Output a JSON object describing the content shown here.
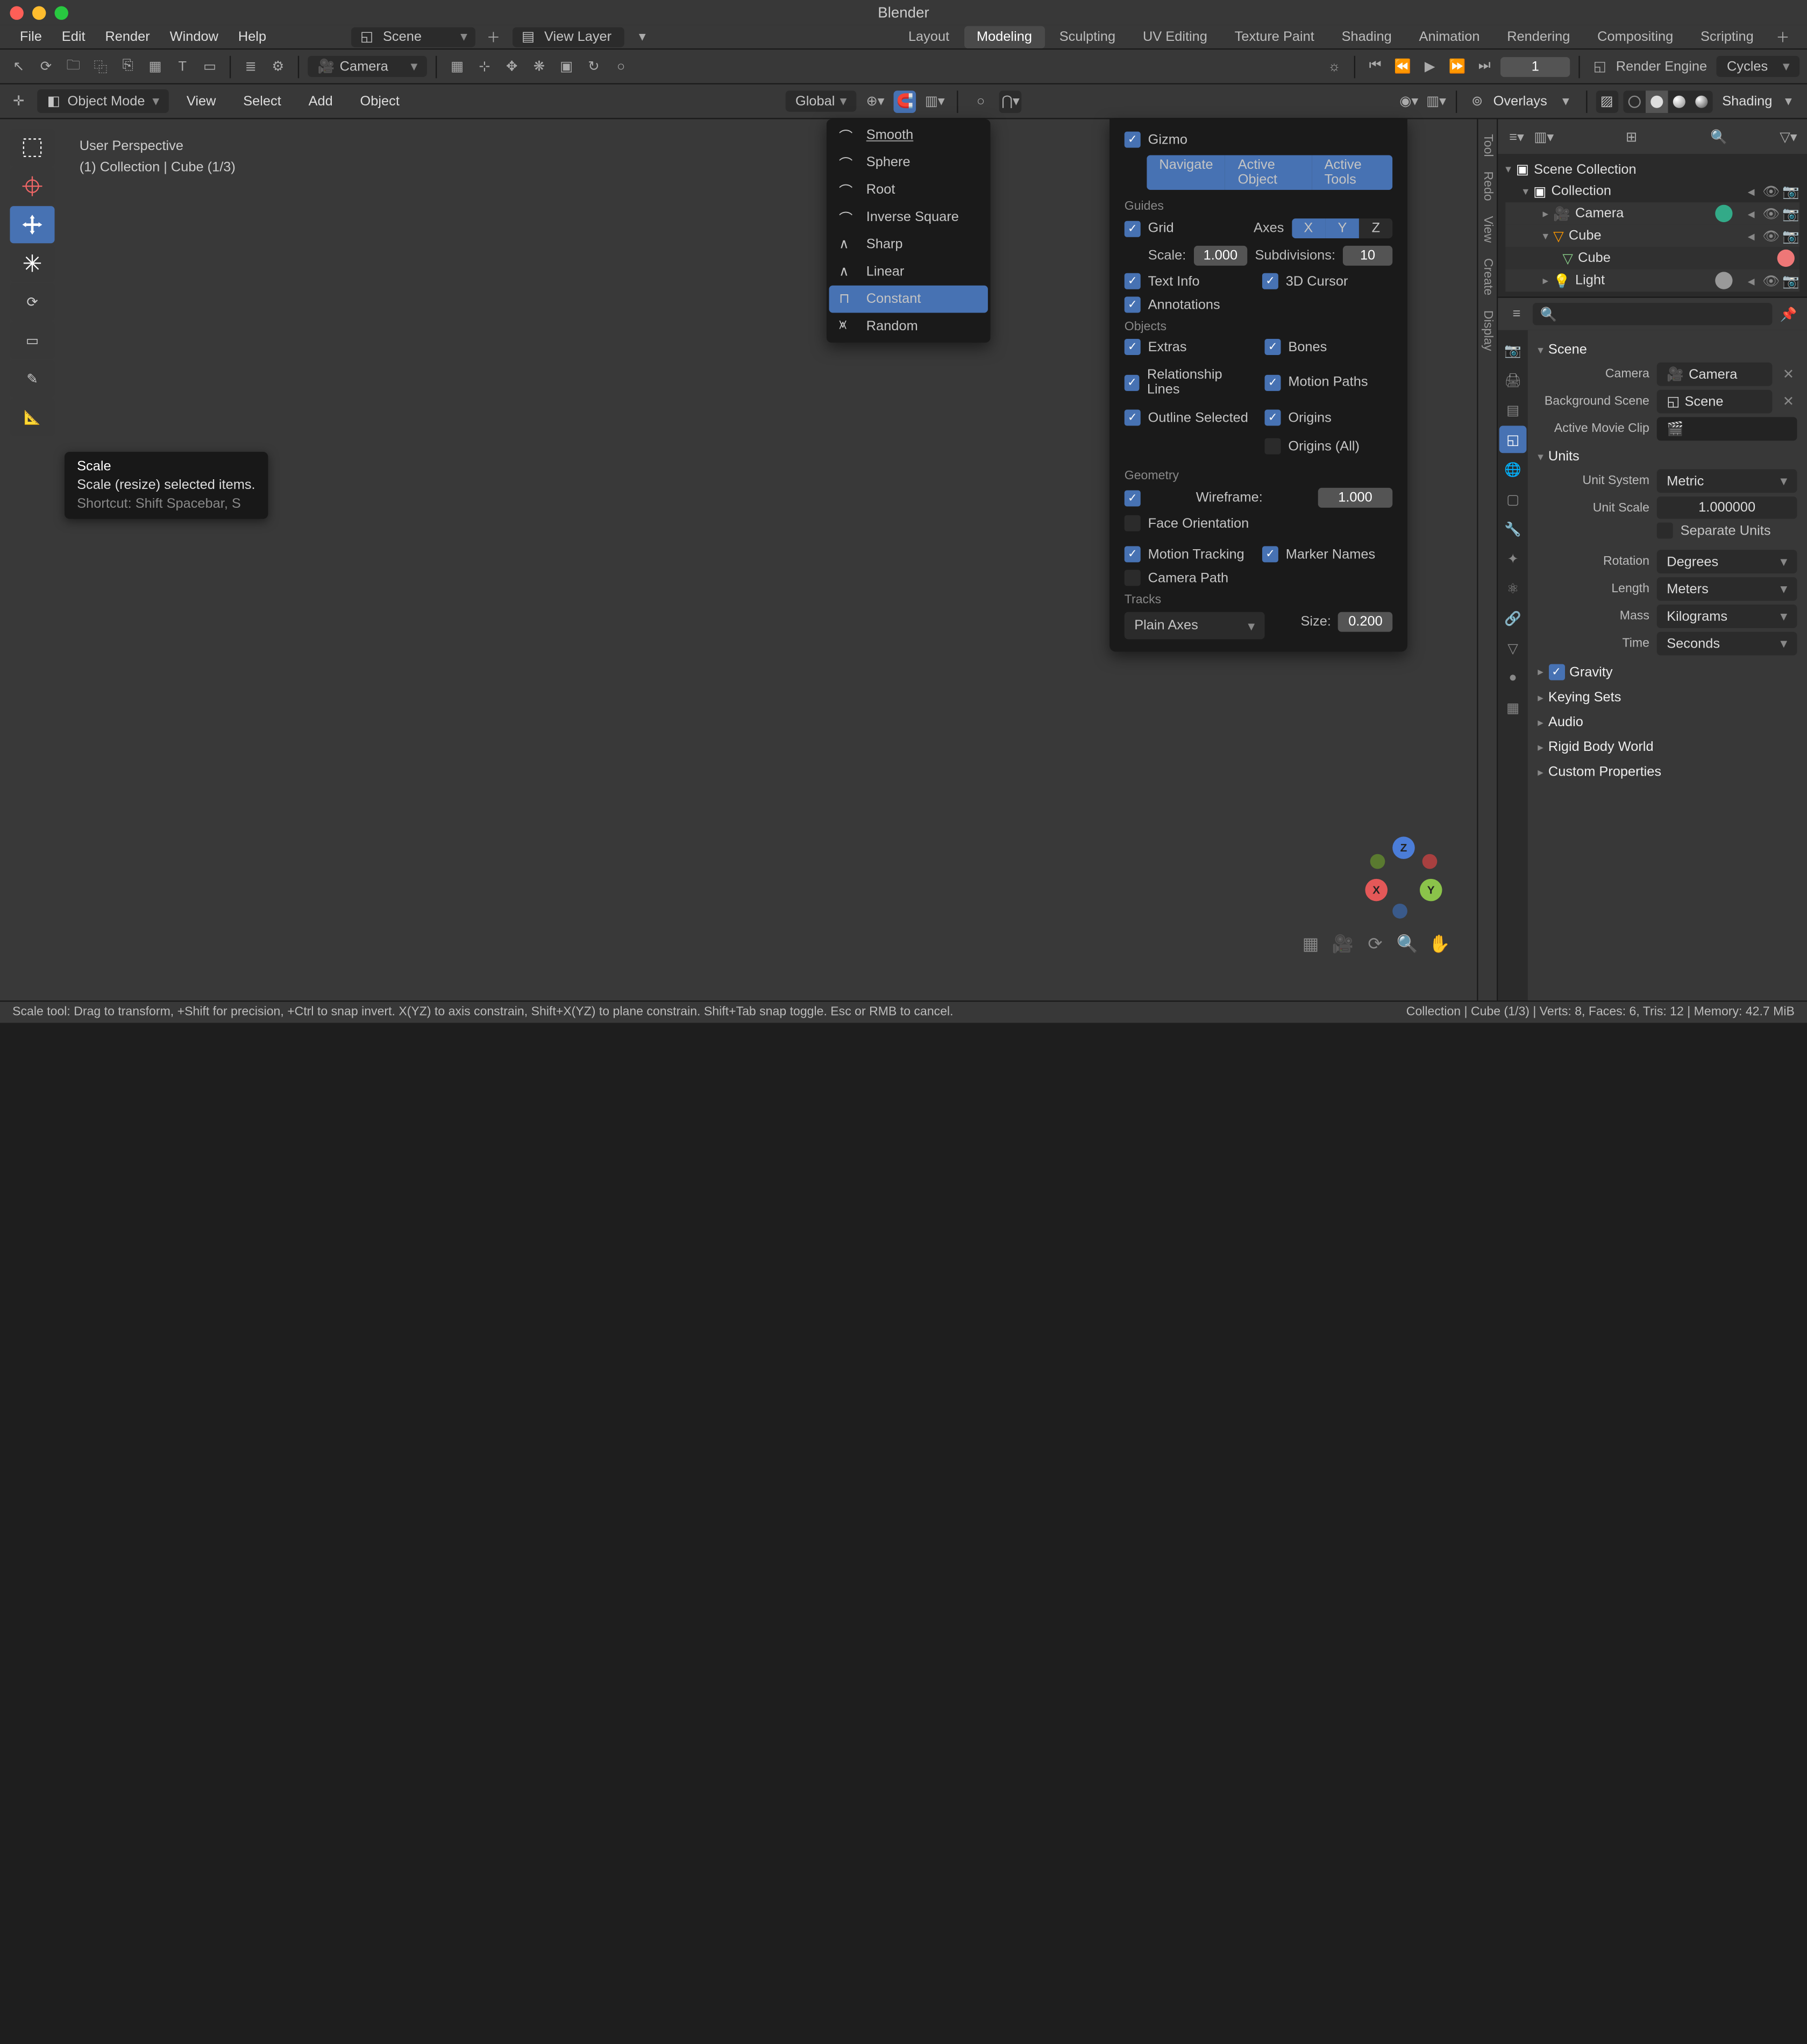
{
  "app_title": "Blender",
  "traffic": {},
  "menu": [
    "File",
    "Edit",
    "Render",
    "Window",
    "Help"
  ],
  "scene_sel": {
    "label": "Scene"
  },
  "layer_sel": {
    "label": "View Layer"
  },
  "workspace_tabs": [
    "Layout",
    "Modeling",
    "Sculpting",
    "UV Editing",
    "Texture Paint",
    "Shading",
    "Animation",
    "Rendering",
    "Compositing",
    "Scripting"
  ],
  "workspace_active": "Modeling",
  "toolrow": {
    "camera": "Camera",
    "frame": "1",
    "render_engine_label": "Render Engine",
    "render_engine": "Cycles"
  },
  "view_header": {
    "mode": "Object Mode",
    "menus": [
      "View",
      "Select",
      "Add",
      "Object"
    ],
    "orientation": "Global",
    "overlays": "Overlays",
    "shading": "Shading"
  },
  "left_tools": [
    "select-box",
    "cursor",
    "move",
    "rotate",
    "scale",
    "transform",
    "annotate",
    "measure"
  ],
  "tooltip": {
    "title": "Scale",
    "desc": "Scale (resize) selected items.",
    "shortcut": "Shortcut: Shift Spacebar, S"
  },
  "vp_info": {
    "line1": "User Perspective",
    "line2": "(1) Collection | Cube (1/3)"
  },
  "falloff_menu": [
    "Smooth",
    "Sphere",
    "Root",
    "Inverse Square",
    "Sharp",
    "Linear",
    "Constant",
    "Random"
  ],
  "falloff_sel": "Constant",
  "overlays_panel": {
    "gizmo": "Gizmo",
    "pills": [
      "Navigate",
      "Active Object",
      "Active Tools"
    ],
    "guides": "Guides",
    "grid": "Grid",
    "axes": "Axes",
    "axX": "X",
    "axY": "Y",
    "axZ": "Z",
    "scale_l": "Scale:",
    "scale_v": "1.000",
    "subdiv_l": "Subdivisions:",
    "subdiv_v": "10",
    "text_info": "Text Info",
    "cursor3d": "3D Cursor",
    "annotations": "Annotations",
    "objects": "Objects",
    "extras": "Extras",
    "bones": "Bones",
    "rel_lines": "Relationship Lines",
    "motion": "Motion Paths",
    "outline_sel": "Outline Selected",
    "origins": "Origins",
    "origins_all": "Origins (All)",
    "geometry": "Geometry",
    "wireframe_l": "Wireframe:",
    "wireframe_v": "1.000",
    "face_orient": "Face Orientation",
    "motion_track": "Motion Tracking",
    "marker_names": "Marker Names",
    "camera_path": "Camera Path",
    "tracks": "Tracks",
    "plain_axes": "Plain Axes",
    "size_l": "Size:",
    "size_v": "0.200"
  },
  "right_tabs": [
    "Tool",
    "Redo",
    "View",
    "Create",
    "Display"
  ],
  "outliner": {
    "root": "Scene Collection",
    "items": [
      {
        "name": "Collection",
        "level": 1,
        "exp": true
      },
      {
        "name": "Camera",
        "level": 2,
        "circle": "teal"
      },
      {
        "name": "Cube",
        "level": 2,
        "exp": true,
        "tri": true
      },
      {
        "name": "Cube",
        "level": 3,
        "circle": "coral"
      },
      {
        "name": "Light",
        "level": 2,
        "circle": "gray"
      }
    ]
  },
  "props": {
    "search_ph": "",
    "scene_head": "Scene",
    "camera_l": "Camera",
    "camera_v": "Camera",
    "bgscene_l": "Background Scene",
    "bgscene_v": "Scene",
    "clip_l": "Active Movie Clip",
    "units": "Units",
    "unit_system_l": "Unit System",
    "unit_system_v": "Metric",
    "unit_scale_l": "Unit Scale",
    "unit_scale_v": "1.000000",
    "sep_units": "Separate Units",
    "rotation_l": "Rotation",
    "rotation_v": "Degrees",
    "length_l": "Length",
    "length_v": "Meters",
    "mass_l": "Mass",
    "mass_v": "Kilograms",
    "time_l": "Time",
    "time_v": "Seconds",
    "sections": [
      "Gravity",
      "Keying Sets",
      "Audio",
      "Rigid Body World",
      "Custom Properties"
    ]
  },
  "status": {
    "left_html": "Scale tool: Drag to transform, +Shift for precision, +Ctrl to snap invert. X(YZ) to axis constrain, Shift+X(YZ) to plane constrain. Shift+Tab snap toggle. Esc or RMB to cancel.",
    "right": "Collection | Cube (1/3) | Verts: 8, Faces: 6, Tris: 12 | Memory: 42.7 MiB"
  }
}
